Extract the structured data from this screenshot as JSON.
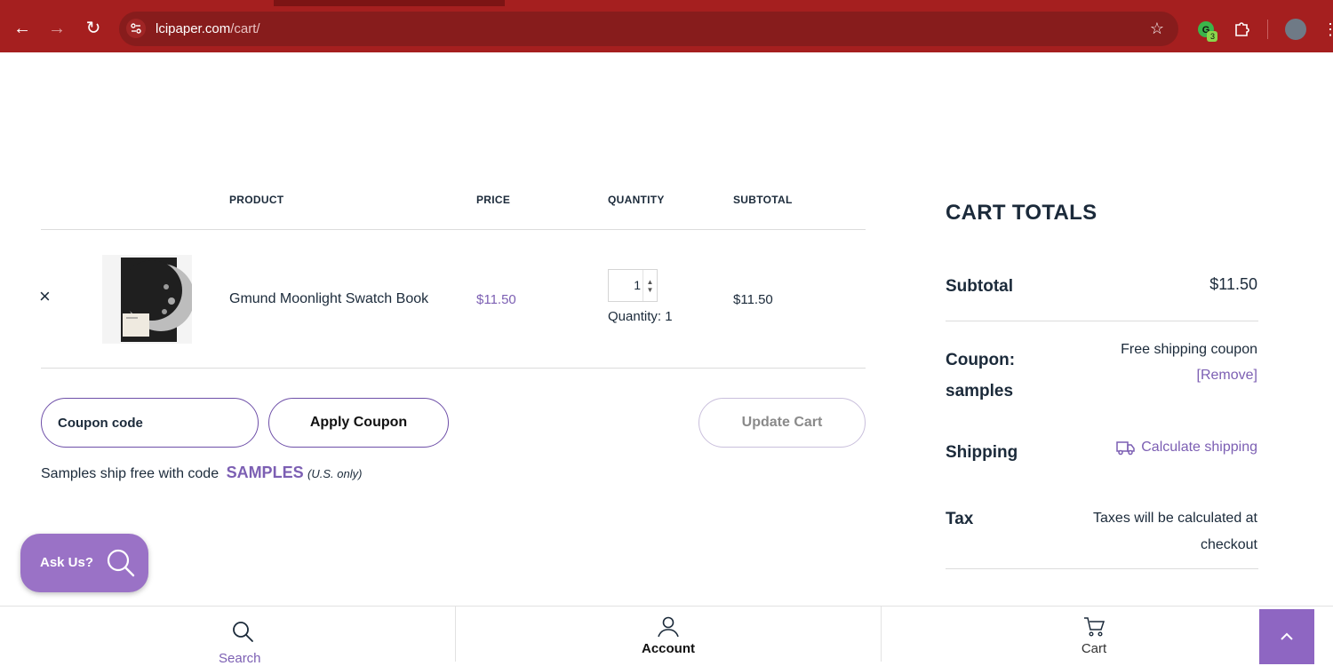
{
  "browser": {
    "url_domain": "lcipaper.com",
    "url_path": "/cart/",
    "extension_badge": "3"
  },
  "cart_table": {
    "headers": [
      "PRODUCT",
      "PRICE",
      "QUANTITY",
      "SUBTOTAL"
    ],
    "item": {
      "name": "Gmund Moonlight Swatch Book",
      "price": "$11.50",
      "quantity": "1",
      "quantity_label": "Quantity: 1",
      "subtotal": "$11.50",
      "remove_symbol": "×"
    },
    "coupon_placeholder": "Coupon code",
    "apply_coupon_label": "Apply Coupon",
    "update_cart_label": "Update Cart",
    "promo_text": "Samples ship free with code",
    "promo_code": "SAMPLES",
    "promo_note": "(U.S. only)"
  },
  "cart_totals": {
    "title": "CART TOTALS",
    "subtotal_label": "Subtotal",
    "subtotal_value": "$11.50",
    "coupon_label_line1": "Coupon:",
    "coupon_label_line2": "samples",
    "coupon_value": "Free shipping coupon",
    "coupon_remove": "[Remove]",
    "shipping_label": "Shipping",
    "shipping_link": "Calculate shipping",
    "tax_label": "Tax",
    "tax_value_line1": "Taxes will be calculated at",
    "tax_value_line2": "checkout"
  },
  "ask_us": {
    "label": "Ask Us?"
  },
  "bottom_bar": {
    "search_label": "Search",
    "account_label": "Account",
    "cart_label": "Cart"
  },
  "colors": {
    "accent": "#7c5fb3",
    "chrome": "#a51f1f",
    "text": "#1b2a3a"
  }
}
